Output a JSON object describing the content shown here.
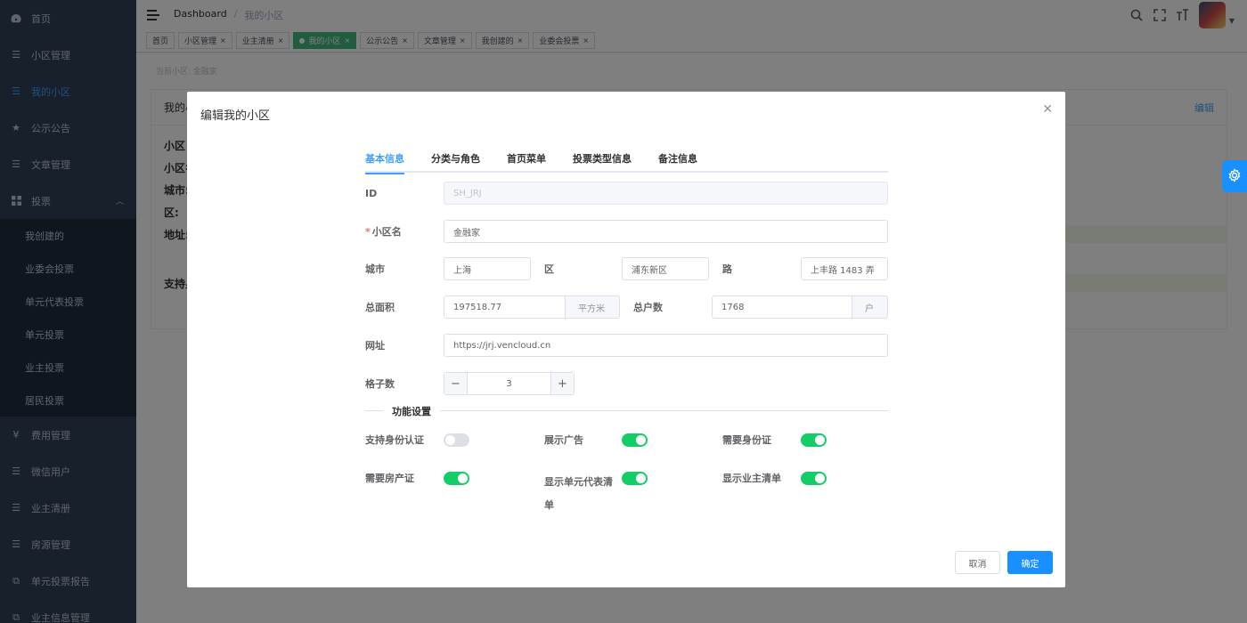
{
  "sidebar": {
    "items": [
      {
        "label": "首页",
        "icon": "dashboard-icon"
      },
      {
        "label": "小区管理",
        "icon": "list-icon"
      },
      {
        "label": "我的小区",
        "icon": "list-icon",
        "active": true
      },
      {
        "label": "公示公告",
        "icon": "star-icon"
      },
      {
        "label": "文章管理",
        "icon": "list-icon"
      },
      {
        "label": "投票",
        "icon": "grid-icon",
        "expanded": true
      }
    ],
    "sub_items": [
      "我创建的",
      "业委会投票",
      "单元代表投票",
      "单元投票",
      "业主投票",
      "居民投票"
    ],
    "items_after": [
      {
        "label": "费用管理",
        "icon": "yen-icon"
      },
      {
        "label": "微信用户",
        "icon": "list-icon"
      },
      {
        "label": "业主清册",
        "icon": "list-icon"
      },
      {
        "label": "房源管理",
        "icon": "list-icon"
      },
      {
        "label": "单元投票报告",
        "icon": "external-link-icon"
      },
      {
        "label": "业主信息管理",
        "icon": "external-link-icon"
      }
    ]
  },
  "navbar": {
    "breadcrumb": [
      "Dashboard",
      "我的小区"
    ]
  },
  "tags": [
    {
      "label": "首页",
      "closable": false
    },
    {
      "label": "小区管理",
      "closable": true
    },
    {
      "label": "业主清册",
      "closable": true
    },
    {
      "label": "我的小区",
      "closable": true,
      "active": true
    },
    {
      "label": "公示公告",
      "closable": true
    },
    {
      "label": "文章管理",
      "closable": true
    },
    {
      "label": "我创建的",
      "closable": true
    },
    {
      "label": "业委会投票",
      "closable": true
    }
  ],
  "background": {
    "hint": "当前小区: 金融家",
    "card_title": "我的小",
    "card_edit": "编辑",
    "lines": [
      "小区",
      "小区名",
      "城市:",
      "区:",
      "地址:"
    ],
    "support": "支持身"
  },
  "dialog": {
    "title": "编辑我的小区",
    "tabs": [
      "基本信息",
      "分类与角色",
      "首页菜单",
      "投票类型信息",
      "备注信息"
    ],
    "fields": {
      "id_label": "ID",
      "id_value": "SH_JRJ",
      "name_label": "小区名",
      "name_value": "金融家",
      "city_label": "城市",
      "city_value": "上海",
      "district_label": "区",
      "district_value": "浦东新区",
      "road_label": "路",
      "road_value": "上丰路 1483 弄",
      "area_label": "总面积",
      "area_value": "197518.77",
      "area_unit": "平方米",
      "households_label": "总户数",
      "households_value": "1768",
      "households_unit": "户",
      "url_label": "网址",
      "url_value": "https://jrj.vencloud.cn",
      "grid_label": "格子数",
      "grid_value": "3"
    },
    "section_title": "功能设置",
    "switches": [
      {
        "label": "支持身份认证",
        "on": false
      },
      {
        "label": "展示广告",
        "on": true
      },
      {
        "label": "需要身份证",
        "on": true
      },
      {
        "label": "需要房产证",
        "on": true
      },
      {
        "label": "显示单元代表清单",
        "on": true
      },
      {
        "label": "显示业主清单",
        "on": true
      }
    ],
    "cancel_label": "取消",
    "ok_label": "确定"
  },
  "colors": {
    "sidebar_bg": "#304156",
    "primary": "#1890ff",
    "tag_active": "#42b983",
    "switch_on": "#13ce66"
  }
}
